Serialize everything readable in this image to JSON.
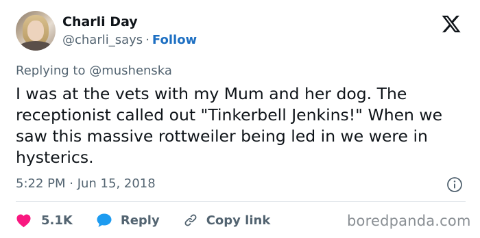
{
  "author": {
    "name": "Charli Day",
    "handle": "@charli_says",
    "separator": "·",
    "follow_label": "Follow"
  },
  "reply_context": {
    "prefix": "Replying to",
    "mention": "@mushenska"
  },
  "tweet": {
    "text": "I was at the vets with my Mum and her dog. The receptionist called out \"Tinkerbell Jenkins!\" When we saw this massive rottweiler being led in we were in hysterics.",
    "timestamp": "5:22 PM · Jun 15, 2018"
  },
  "actions": {
    "like_count": "5.1K",
    "reply_label": "Reply",
    "copy_label": "Copy link"
  },
  "watermark": "boredpanda.com",
  "colors": {
    "like_red": "#f91880",
    "reply_blue": "#1d9bf0",
    "follow_blue": "#1d6fc2",
    "secondary_gray": "#536471"
  },
  "icons": {
    "logo": "x-logo-icon",
    "info": "info-icon",
    "like": "heart-icon",
    "reply": "speech-bubble-icon",
    "copy": "link-icon"
  }
}
